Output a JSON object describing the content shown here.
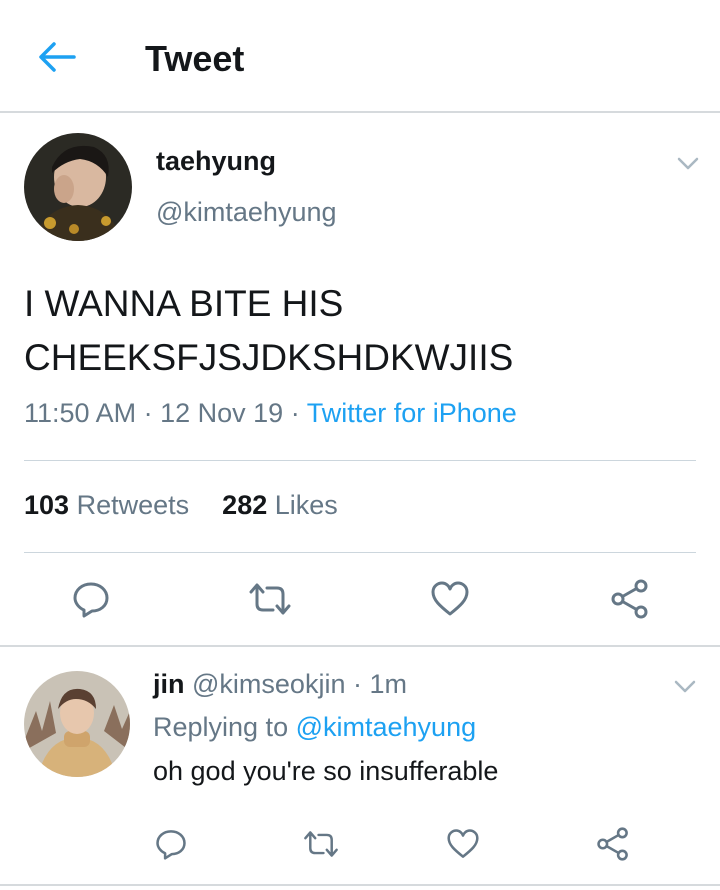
{
  "header": {
    "title": "Tweet"
  },
  "tweet": {
    "display_name": "taehyung",
    "handle": "@kimtaehyung",
    "text_line1": "I WANNA BITE HIS",
    "text_line2": "CHEEKSFJSJDKSHDKWJIIS",
    "time": "11:50 AM",
    "date": "12 Nov 19",
    "source": "Twitter for iPhone",
    "retweet_count": "103",
    "retweet_label": "Retweets",
    "like_count": "282",
    "like_label": "Likes"
  },
  "reply": {
    "display_name": "jin",
    "handle": "@kimseokjin",
    "age": "1m",
    "replying_prefix": "Replying to",
    "replying_handle": "@kimtaehyung",
    "text": "oh god you're so insufferable"
  },
  "icons": [
    "back-arrow-icon",
    "chevron-down-icon",
    "reply-icon",
    "retweet-icon",
    "like-icon",
    "share-icon"
  ],
  "colors": {
    "accent": "#1da1f2",
    "secondary_text": "#657786",
    "primary_text": "#14171a",
    "icon_gray": "#657786",
    "divider": "#ccd6dd"
  }
}
